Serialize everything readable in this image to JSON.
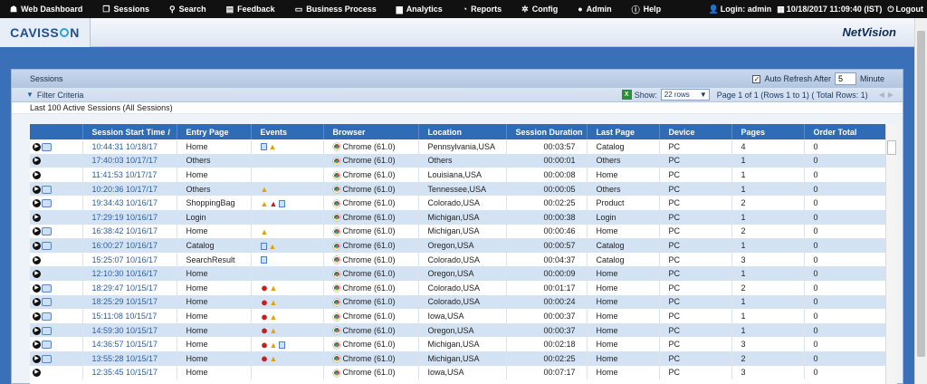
{
  "nav": {
    "items": [
      {
        "icon": "dashboard-icon",
        "glyph": "☗",
        "label": "Web Dashboard"
      },
      {
        "icon": "sessions-icon",
        "glyph": "❐",
        "label": "Sessions"
      },
      {
        "icon": "search-icon",
        "glyph": "⚲",
        "label": "Search"
      },
      {
        "icon": "feedback-icon",
        "glyph": "▤",
        "label": "Feedback"
      },
      {
        "icon": "business-process-icon",
        "glyph": "▭",
        "label": "Business Process"
      },
      {
        "icon": "analytics-icon",
        "glyph": "▆",
        "label": "Analytics"
      },
      {
        "icon": "reports-icon",
        "glyph": "◔",
        "label": "Reports"
      },
      {
        "icon": "config-icon",
        "glyph": "✲",
        "label": "Config"
      },
      {
        "icon": "admin-icon",
        "glyph": "●",
        "label": "Admin"
      },
      {
        "icon": "help-icon",
        "glyph": "ⓘ",
        "label": "Help"
      }
    ],
    "login": "Login: admin",
    "datetime": "10/18/2017 11:09:40 (IST)",
    "logout": "Logout"
  },
  "brand": {
    "logo_prefix": "CAVISS",
    "logo_suffix": "N",
    "product": "NetVision"
  },
  "panel": {
    "title": "Sessions",
    "auto_refresh_label": "Auto Refresh After",
    "auto_refresh_value": "5",
    "auto_refresh_unit": "Minute",
    "auto_refresh_checked": true,
    "filter_label": "Filter Criteria",
    "show_label": "Show:",
    "show_value": "22 rows",
    "page_info": "Page 1 of 1 (Rows 1 to 1) ( Total Rows: 1)",
    "subtitle": "Last 100 Active Sessions (All Sessions)"
  },
  "table": {
    "columns": [
      "",
      "Session Start Time",
      "Entry Page",
      "Events",
      "Browser",
      "Location",
      "Session Duration",
      "Last Page",
      "Device",
      "Pages",
      "Order Total"
    ],
    "sort_indicator": "/",
    "rows": [
      {
        "chat": true,
        "start": "10:44:31 10/18/17",
        "entry": "Home",
        "events": [
          "page",
          "warn"
        ],
        "browser": "Chrome (61.0)",
        "location": "Pennsylvania,USA",
        "duration": "00:03:57",
        "last": "Catalog",
        "device": "PC",
        "pages": "4",
        "order": "0"
      },
      {
        "chat": false,
        "start": "17:40:03 10/17/17",
        "entry": "Others",
        "events": [],
        "browser": "Chrome (61.0)",
        "location": "Others",
        "duration": "00:00:01",
        "last": "Others",
        "device": "PC",
        "pages": "1",
        "order": "0"
      },
      {
        "chat": false,
        "start": "11:41:53 10/17/17",
        "entry": "Home",
        "events": [],
        "browser": "Chrome (61.0)",
        "location": "Louisiana,USA",
        "duration": "00:00:08",
        "last": "Home",
        "device": "PC",
        "pages": "1",
        "order": "0"
      },
      {
        "chat": true,
        "start": "10:20:36 10/17/17",
        "entry": "Others",
        "events": [
          "warn"
        ],
        "browser": "Chrome (61.0)",
        "location": "Tennessee,USA",
        "duration": "00:00:05",
        "last": "Others",
        "device": "PC",
        "pages": "1",
        "order": "0"
      },
      {
        "chat": true,
        "start": "19:34:43 10/16/17",
        "entry": "ShoppingBag",
        "events": [
          "warn",
          "err",
          "page"
        ],
        "browser": "Chrome (61.0)",
        "location": "Colorado,USA",
        "duration": "00:02:25",
        "last": "Product",
        "device": "PC",
        "pages": "2",
        "order": "0"
      },
      {
        "chat": false,
        "start": "17:29:19 10/16/17",
        "entry": "Login",
        "events": [],
        "browser": "Chrome (61.0)",
        "location": "Michigan,USA",
        "duration": "00:00:38",
        "last": "Login",
        "device": "PC",
        "pages": "1",
        "order": "0"
      },
      {
        "chat": true,
        "start": "16:38:42 10/16/17",
        "entry": "Home",
        "events": [
          "warn"
        ],
        "browser": "Chrome (61.0)",
        "location": "Michigan,USA",
        "duration": "00:00:46",
        "last": "Home",
        "device": "PC",
        "pages": "2",
        "order": "0"
      },
      {
        "chat": true,
        "start": "16:00:27 10/16/17",
        "entry": "Catalog",
        "events": [
          "page",
          "warn"
        ],
        "browser": "Chrome (61.0)",
        "location": "Oregon,USA",
        "duration": "00:00:57",
        "last": "Catalog",
        "device": "PC",
        "pages": "1",
        "order": "0"
      },
      {
        "chat": false,
        "start": "15:25:07 10/16/17",
        "entry": "SearchResult",
        "events": [
          "page"
        ],
        "browser": "Chrome (61.0)",
        "location": "Colorado,USA",
        "duration": "00:04:37",
        "last": "Catalog",
        "device": "PC",
        "pages": "3",
        "order": "0"
      },
      {
        "chat": false,
        "start": "12:10:30 10/16/17",
        "entry": "Home",
        "events": [],
        "browser": "Chrome (61.0)",
        "location": "Oregon,USA",
        "duration": "00:00:09",
        "last": "Home",
        "device": "PC",
        "pages": "1",
        "order": "0"
      },
      {
        "chat": true,
        "start": "18:29:47 10/15/17",
        "entry": "Home",
        "events": [
          "bug",
          "warn"
        ],
        "browser": "Chrome (61.0)",
        "location": "Colorado,USA",
        "duration": "00:01:17",
        "last": "Home",
        "device": "PC",
        "pages": "2",
        "order": "0"
      },
      {
        "chat": true,
        "start": "18:25:29 10/15/17",
        "entry": "Home",
        "events": [
          "bug",
          "warn"
        ],
        "browser": "Chrome (61.0)",
        "location": "Colorado,USA",
        "duration": "00:00:24",
        "last": "Home",
        "device": "PC",
        "pages": "1",
        "order": "0"
      },
      {
        "chat": true,
        "start": "15:11:08 10/15/17",
        "entry": "Home",
        "events": [
          "bug",
          "warn"
        ],
        "browser": "Chrome (61.0)",
        "location": "Iowa,USA",
        "duration": "00:00:37",
        "last": "Home",
        "device": "PC",
        "pages": "1",
        "order": "0"
      },
      {
        "chat": true,
        "start": "14:59:30 10/15/17",
        "entry": "Home",
        "events": [
          "bug",
          "warn"
        ],
        "browser": "Chrome (61.0)",
        "location": "Oregon,USA",
        "duration": "00:00:37",
        "last": "Home",
        "device": "PC",
        "pages": "1",
        "order": "0"
      },
      {
        "chat": true,
        "start": "14:36:57 10/15/17",
        "entry": "Home",
        "events": [
          "bug",
          "warn",
          "page"
        ],
        "browser": "Chrome (61.0)",
        "location": "Michigan,USA",
        "duration": "00:02:18",
        "last": "Home",
        "device": "PC",
        "pages": "3",
        "order": "0"
      },
      {
        "chat": true,
        "start": "13:55:28 10/15/17",
        "entry": "Home",
        "events": [
          "bug",
          "warn"
        ],
        "browser": "Chrome (61.0)",
        "location": "Michigan,USA",
        "duration": "00:02:25",
        "last": "Home",
        "device": "PC",
        "pages": "2",
        "order": "0"
      },
      {
        "chat": false,
        "start": "12:35:45 10/15/17",
        "entry": "Home",
        "events": [],
        "browser": "Chrome (61.0)",
        "location": "Iowa,USA",
        "duration": "00:07:17",
        "last": "Home",
        "device": "PC",
        "pages": "3",
        "order": "0"
      }
    ]
  },
  "colors": {
    "nav_bg": "#111111",
    "header_blue": "#2f6cb5",
    "row_alt": "#d4e3f4",
    "time_link": "#2d5f9e"
  }
}
